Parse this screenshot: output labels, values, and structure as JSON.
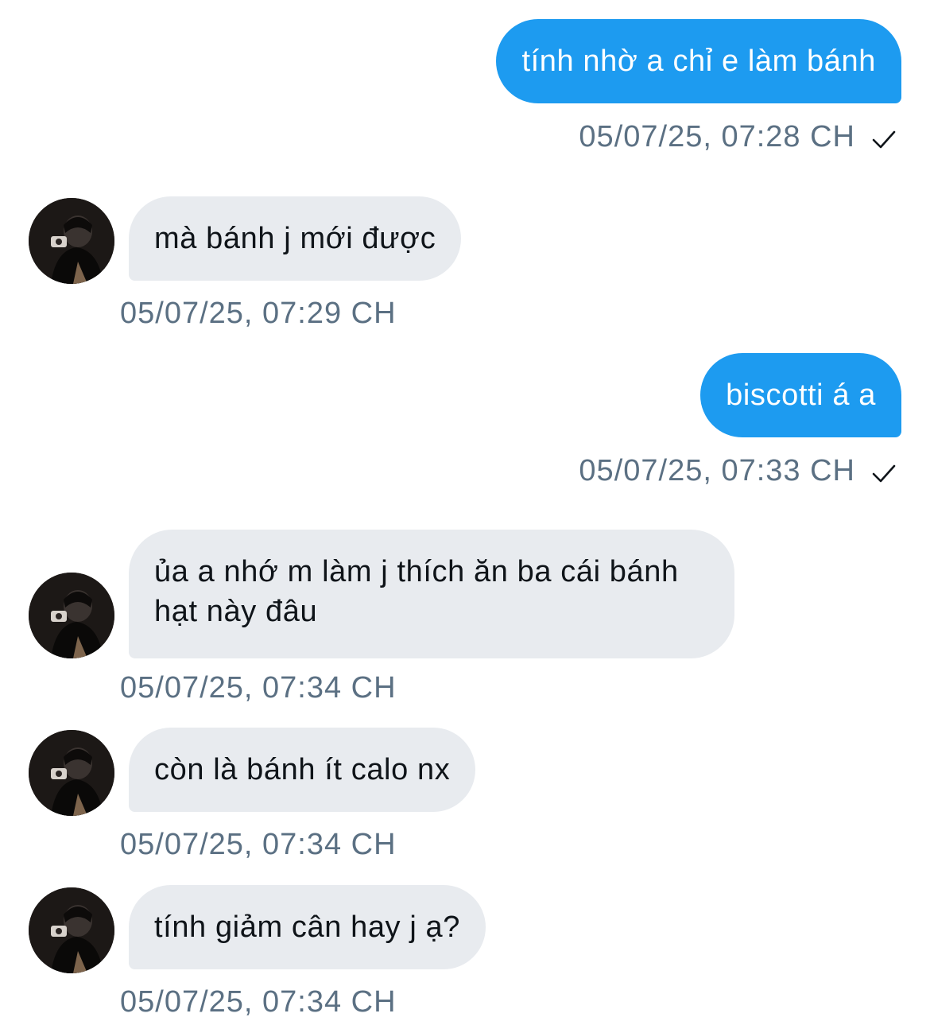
{
  "messages": [
    {
      "direction": "outgoing",
      "text": "tính nhờ a chỉ e làm bánh",
      "time": "05/07/25, 07:28 CH",
      "status_icon": "check-icon"
    },
    {
      "direction": "incoming",
      "text": "mà bánh j mới được",
      "time": "05/07/25, 07:29 CH",
      "avatar_icon": "user-avatar"
    },
    {
      "direction": "outgoing",
      "text": "biscotti á a",
      "time": "05/07/25, 07:33 CH",
      "status_icon": "check-icon"
    },
    {
      "direction": "incoming",
      "text": "ủa a nhớ m làm j thích ăn ba cái bánh hạt này đâu",
      "time": "05/07/25, 07:34 CH",
      "avatar_icon": "user-avatar"
    },
    {
      "direction": "incoming",
      "text": "còn là bánh ít calo nx",
      "time": "05/07/25, 07:34 CH",
      "avatar_icon": "user-avatar"
    },
    {
      "direction": "incoming",
      "text": "tính giảm cân hay j ạ?",
      "time": "05/07/25, 07:34 CH",
      "avatar_icon": "user-avatar"
    }
  ],
  "colors": {
    "outgoing_bubble": "#1d9bf0",
    "incoming_bubble": "#e8ebef",
    "timestamp": "#5b7083"
  }
}
